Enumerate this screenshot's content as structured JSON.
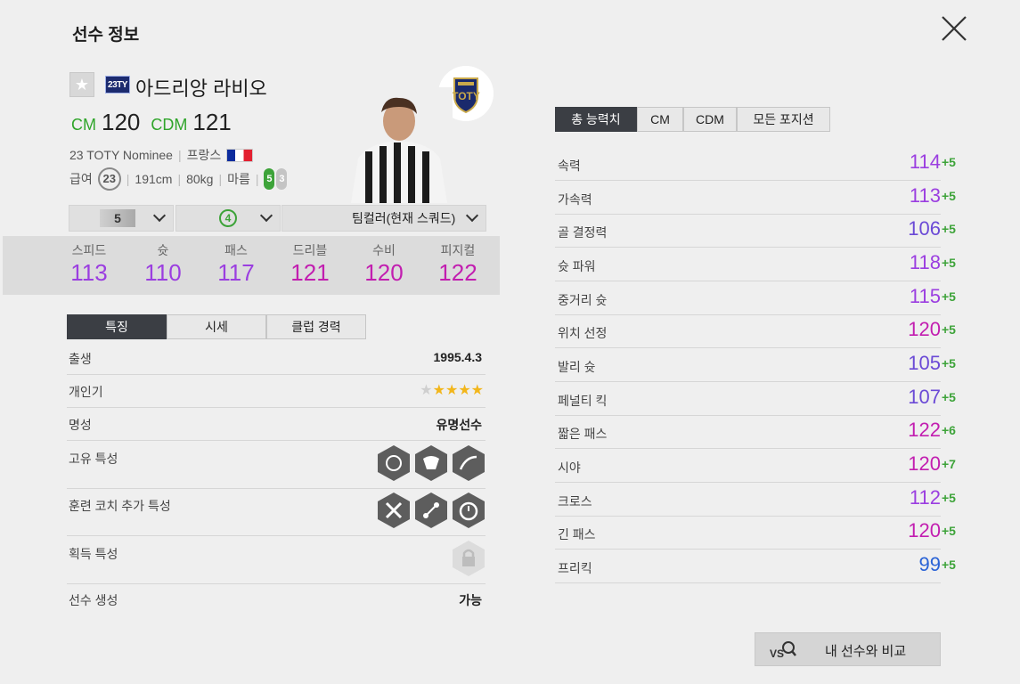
{
  "header": {
    "title": "선수 정보"
  },
  "player": {
    "season": "23TY",
    "name": "아드리앙 라비오",
    "positions": [
      {
        "pos": "CM",
        "ovr": "120"
      },
      {
        "pos": "CDM",
        "ovr": "121"
      }
    ],
    "season_name": "23 TOTY Nominee",
    "nation": "프랑스",
    "salary_label": "급여",
    "salary": "23",
    "height": "191cm",
    "weight": "80kg",
    "body": "마름",
    "weak_foot_left": "5",
    "weak_foot_right": "3"
  },
  "selectors": {
    "enhance": "5",
    "training": "4",
    "teamcolor": "팀컬러(현재 스쿼드)"
  },
  "summary": [
    {
      "label": "스피드",
      "value": "113"
    },
    {
      "label": "슛",
      "value": "110"
    },
    {
      "label": "패스",
      "value": "117"
    },
    {
      "label": "드리블",
      "value": "121"
    },
    {
      "label": "수비",
      "value": "120"
    },
    {
      "label": "피지컬",
      "value": "122"
    }
  ],
  "left_tabs": [
    "특징",
    "시세",
    "클럽 경력"
  ],
  "info": {
    "birth_label": "출생",
    "birth": "1995.4.3",
    "popularity_label": "개인기",
    "fame_label": "명성",
    "fame": "유명선수",
    "unique_label": "고유 특성",
    "coach_label": "훈련 코치 추가 특성",
    "acquired_label": "획득 특성",
    "generate_label": "선수 생성",
    "generate": "가능"
  },
  "popularity_stars": 4,
  "right_tabs": [
    "총 능력치",
    "CM",
    "CDM",
    "모든 포지션"
  ],
  "stats": [
    {
      "label": "속력",
      "value": "114",
      "bonus": "+5"
    },
    {
      "label": "가속력",
      "value": "113",
      "bonus": "+5"
    },
    {
      "label": "골 결정력",
      "value": "106",
      "bonus": "+5"
    },
    {
      "label": "슛 파워",
      "value": "118",
      "bonus": "+5"
    },
    {
      "label": "중거리 슛",
      "value": "115",
      "bonus": "+5"
    },
    {
      "label": "위치 선정",
      "value": "120",
      "bonus": "+5"
    },
    {
      "label": "발리 슛",
      "value": "105",
      "bonus": "+5"
    },
    {
      "label": "페널티 킥",
      "value": "107",
      "bonus": "+5"
    },
    {
      "label": "짧은 패스",
      "value": "122",
      "bonus": "+6"
    },
    {
      "label": "시야",
      "value": "120",
      "bonus": "+7"
    },
    {
      "label": "크로스",
      "value": "112",
      "bonus": "+5"
    },
    {
      "label": "긴 패스",
      "value": "120",
      "bonus": "+5"
    },
    {
      "label": "프리킥",
      "value": "99",
      "bonus": "+5"
    }
  ],
  "compare_button": "내 선수와 비교",
  "colors": {
    "accent_green": "#2fa52a",
    "tab_active": "#3b3e44"
  }
}
